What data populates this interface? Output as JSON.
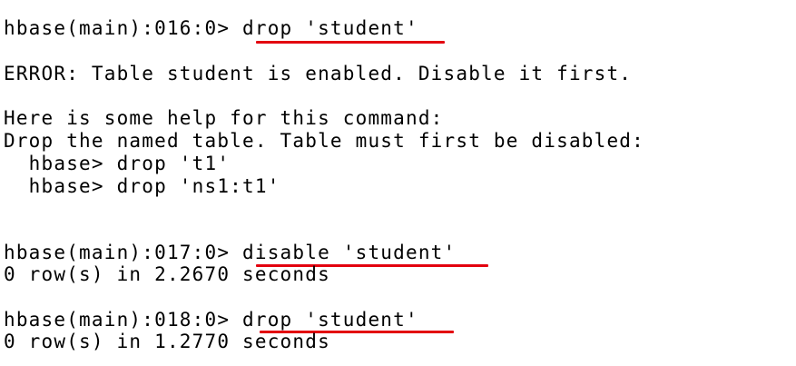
{
  "terminal": {
    "block1": {
      "prompt": "hbase(main):016:0> ",
      "command": "drop 'student'",
      "error": "ERROR: Table student is enabled. Disable it first.",
      "help_intro": "Here is some help for this command:",
      "help_desc": "Drop the named table. Table must first be disabled:",
      "example1": "  hbase> drop 't1'",
      "example2": "  hbase> drop 'ns1:t1'"
    },
    "block2": {
      "prompt": "hbase(main):017:0> ",
      "command": "disable 'student'",
      "result": "0 row(s) in 2.2670 seconds"
    },
    "block3": {
      "prompt": "hbase(main):018:0> ",
      "command": "drop 'student'",
      "result": "0 row(s) in 1.2770 seconds"
    }
  },
  "colors": {
    "background": "#ffffff",
    "text": "#000000",
    "highlight_underline": "#e3000f"
  }
}
